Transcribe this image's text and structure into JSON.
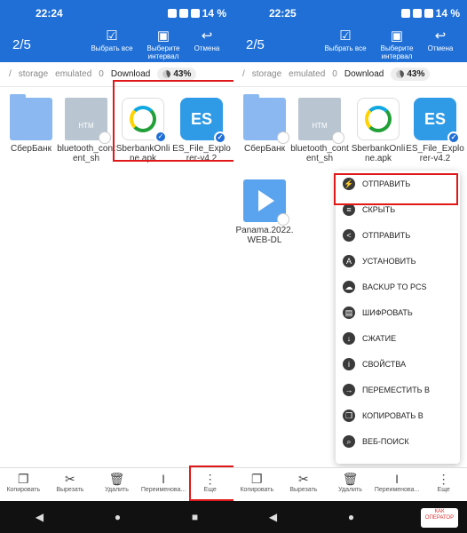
{
  "left": {
    "status": {
      "time": "22:24",
      "battery": "14 %"
    },
    "appbar": {
      "count": "2/5",
      "select_all": "Выбрать все",
      "select_interval": "Выберите интервал",
      "cancel": "Отмена"
    },
    "crumbs": [
      "/",
      "storage",
      "emulated",
      "0",
      "Download"
    ],
    "storage_pct": "43%",
    "files": [
      {
        "name": "СберБанк",
        "kind": "folder",
        "selected": false
      },
      {
        "name": "bluetooth_content_sh",
        "kind": "htm",
        "icon_text": "HTM",
        "selected": false
      },
      {
        "name": "SberbankOnline.apk",
        "kind": "sber",
        "selected": true
      },
      {
        "name": "ES_File_Explorer-v4.2",
        "kind": "es",
        "selected": true
      }
    ],
    "bottom": [
      "Копировать",
      "Вырезать",
      "Удалить",
      "Переименова...",
      "Еще"
    ]
  },
  "right": {
    "status": {
      "time": "22:25",
      "battery": "14 %"
    },
    "appbar": {
      "count": "2/5",
      "select_all": "Выбрать все",
      "select_interval": "Выберите интервал",
      "cancel": "Отмена"
    },
    "crumbs": [
      "/",
      "storage",
      "emulated",
      "0",
      "Download"
    ],
    "storage_pct": "43%",
    "files": [
      {
        "name": "СберБанк",
        "kind": "folder",
        "selected": false
      },
      {
        "name": "bluetooth_content_sh",
        "kind": "htm",
        "icon_text": "HTM",
        "selected": false
      },
      {
        "name": "SberbankOnline.apk",
        "kind": "sber",
        "selected": true
      },
      {
        "name": "ES_File_Explorer-v4.2",
        "kind": "es",
        "selected": true
      },
      {
        "name": "Panama.2022.WEB-DL",
        "kind": "video",
        "selected": false
      }
    ],
    "menu": [
      {
        "label": "ОТПРАВИТЬ",
        "icon": "send-icon"
      },
      {
        "label": "СКРЫТЬ",
        "icon": "hide-icon"
      },
      {
        "label": "ОТПРАВИТЬ",
        "icon": "share-icon"
      },
      {
        "label": "УСТАНОВИТЬ",
        "icon": "android-icon"
      },
      {
        "label": "BACKUP TO PCS",
        "icon": "cloud-icon"
      },
      {
        "label": "ШИФРОВАТЬ",
        "icon": "encrypt-icon"
      },
      {
        "label": "СЖАТИЕ",
        "icon": "compress-icon"
      },
      {
        "label": "СВОЙСТВА",
        "icon": "info-icon"
      },
      {
        "label": "ПЕРЕМЕСТИТЬ В",
        "icon": "move-icon"
      },
      {
        "label": "КОПИРОВАТЬ В",
        "icon": "copy-icon"
      },
      {
        "label": "ВЕБ-ПОИСК",
        "icon": "web-search-icon"
      }
    ],
    "bottom": [
      "Копировать",
      "Вырезать",
      "Удалить",
      "Переименова...",
      "Еще"
    ]
  },
  "watermark": "КАК ОПЕРАТОР"
}
